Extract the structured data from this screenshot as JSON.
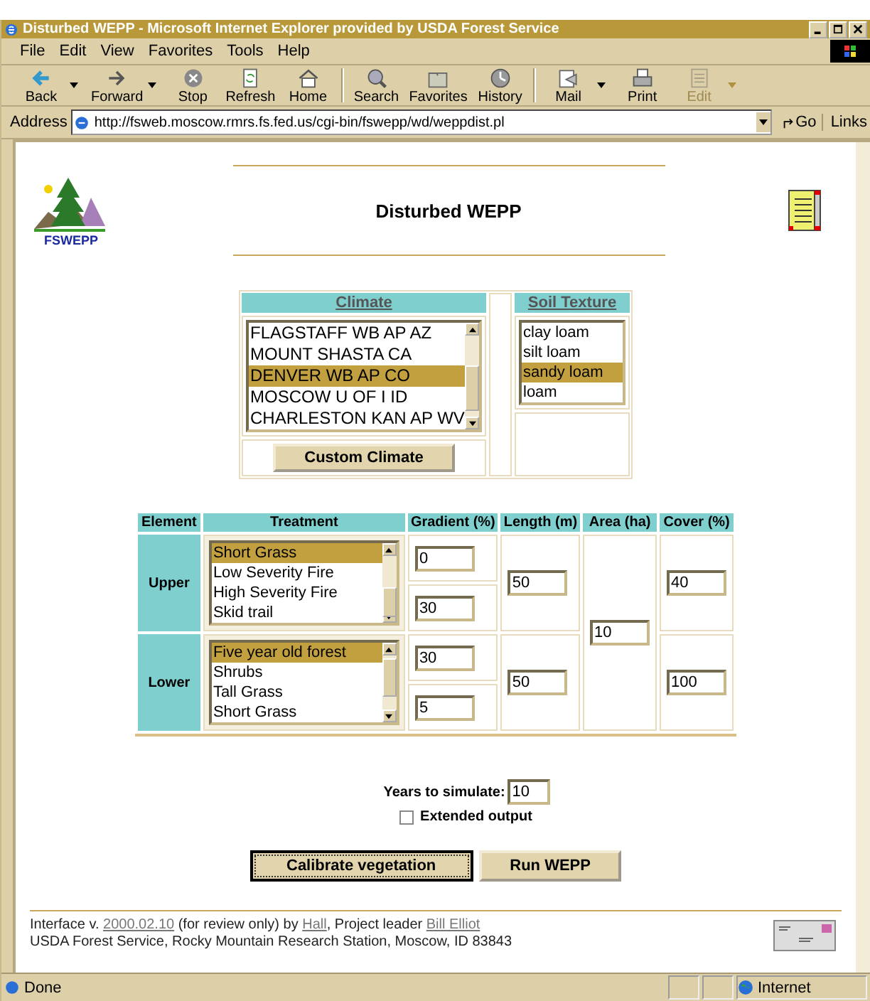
{
  "window": {
    "title": "Disturbed WEPP - Microsoft Internet Explorer provided by USDA Forest Service"
  },
  "menu": [
    "File",
    "Edit",
    "View",
    "Favorites",
    "Tools",
    "Help"
  ],
  "toolbar": [
    [
      {
        "label": "Back",
        "dropdown": true,
        "disabled": false
      },
      {
        "label": "Forward",
        "dropdown": true,
        "disabled": false
      },
      {
        "label": "Stop",
        "dropdown": false,
        "disabled": false
      },
      {
        "label": "Refresh",
        "dropdown": false,
        "disabled": false
      },
      {
        "label": "Home",
        "dropdown": false,
        "disabled": false
      }
    ],
    [
      {
        "label": "Search",
        "dropdown": false,
        "disabled": false
      },
      {
        "label": "Favorites",
        "dropdown": false,
        "disabled": false
      },
      {
        "label": "History",
        "dropdown": false,
        "disabled": false
      }
    ],
    [
      {
        "label": "Mail",
        "dropdown": true,
        "disabled": false
      },
      {
        "label": "Print",
        "dropdown": false,
        "disabled": false
      },
      {
        "label": "Edit",
        "dropdown": true,
        "disabled": true
      }
    ]
  ],
  "address": {
    "label": "Address",
    "url": "http://fsweb.moscow.rmrs.fs.fed.us/cgi-bin/fswepp/wd/weppdist.pl",
    "go": "Go",
    "links": "Links"
  },
  "logo_text": "FSWEPP",
  "heading": "Disturbed WEPP",
  "climate": {
    "header": "Climate",
    "options": [
      {
        "label": "FLAGSTAFF WB AP AZ",
        "selected": false
      },
      {
        "label": "MOUNT SHASTA CA",
        "selected": false
      },
      {
        "label": "DENVER WB AP CO",
        "selected": true
      },
      {
        "label": "MOSCOW U OF I ID",
        "selected": false
      },
      {
        "label": "CHARLESTON KAN AP WV",
        "selected": false
      }
    ],
    "button": "Custom Climate"
  },
  "soil": {
    "header": "Soil Texture",
    "options": [
      {
        "label": "clay loam",
        "selected": false
      },
      {
        "label": "silt loam",
        "selected": false
      },
      {
        "label": "sandy loam",
        "selected": true
      },
      {
        "label": "loam",
        "selected": false
      }
    ]
  },
  "table": {
    "columns": [
      "Element",
      "Treatment",
      "Gradient (%)",
      "Length (m)",
      "Area (ha)",
      "Cover (%)"
    ],
    "rows": [
      {
        "element": "Upper",
        "treatments": [
          {
            "label": "Short Grass",
            "selected": true
          },
          {
            "label": "Low Severity Fire",
            "selected": false
          },
          {
            "label": "High Severity Fire",
            "selected": false
          },
          {
            "label": "Skid trail",
            "selected": false
          }
        ],
        "gradients": [
          "0",
          "30"
        ],
        "length": "50",
        "cover": "40"
      },
      {
        "element": "Lower",
        "treatments": [
          {
            "label": "Five year old forest",
            "selected": true
          },
          {
            "label": "Shrubs",
            "selected": false
          },
          {
            "label": "Tall Grass",
            "selected": false
          },
          {
            "label": "Short Grass",
            "selected": false
          }
        ],
        "gradients": [
          "30",
          "5"
        ],
        "length": "50",
        "cover": "100"
      }
    ],
    "area": "10"
  },
  "years": {
    "label": "Years to simulate:",
    "value": "10"
  },
  "extended": {
    "label": "Extended output",
    "checked": false
  },
  "buttons": [
    {
      "label": "Calibrate vegetation",
      "focused": true
    },
    {
      "label": "Run WEPP",
      "focused": false
    }
  ],
  "footer": {
    "line1": [
      {
        "text": "Interface v. ",
        "link": false
      },
      {
        "text": "2000.02.10",
        "link": true
      },
      {
        "text": " (for review only) by ",
        "link": false
      },
      {
        "text": "Hall",
        "link": true
      },
      {
        "text": ", Project leader ",
        "link": false
      },
      {
        "text": "Bill Elliot",
        "link": true
      }
    ],
    "line2": "USDA Forest Service, Rocky Mountain Research Station, Moscow, ID 83843"
  },
  "status": {
    "text": "Done",
    "zone": "Internet"
  }
}
